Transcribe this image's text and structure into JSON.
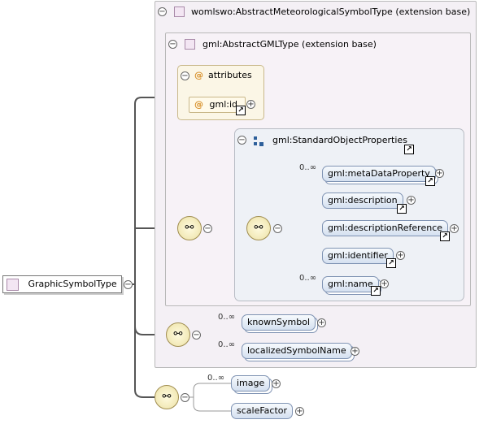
{
  "root": {
    "label": "GraphicSymbolType"
  },
  "extension_outer": {
    "label": "womlswo:AbstractMeteorologicalSymbolType (extension base)"
  },
  "extension_inner": {
    "label": "gml:AbstractGMLType (extension base)"
  },
  "attributes": {
    "title": "attributes",
    "items": [
      {
        "label": "gml:id"
      }
    ]
  },
  "std_props": {
    "label": "gml:StandardObjectProperties",
    "elements": [
      {
        "label": "gml:metaDataProperty",
        "cardinality": "0..∞"
      },
      {
        "label": "gml:description",
        "cardinality": ""
      },
      {
        "label": "gml:descriptionReference",
        "cardinality": ""
      },
      {
        "label": "gml:identifier",
        "cardinality": ""
      },
      {
        "label": "gml:name",
        "cardinality": "0..∞"
      }
    ]
  },
  "outer_sequence": {
    "elements": [
      {
        "label": "knownSymbol",
        "cardinality": "0..∞"
      },
      {
        "label": "localizedSymbolName",
        "cardinality": "0..∞"
      }
    ]
  },
  "root_sequence": {
    "elements": [
      {
        "label": "image",
        "cardinality": "0..∞"
      },
      {
        "label": "scaleFactor",
        "cardinality": ""
      }
    ]
  },
  "symbols": {
    "collapse": "−",
    "expand": "+",
    "link": "↗",
    "attribute": "@",
    "sequence": "⚯"
  }
}
